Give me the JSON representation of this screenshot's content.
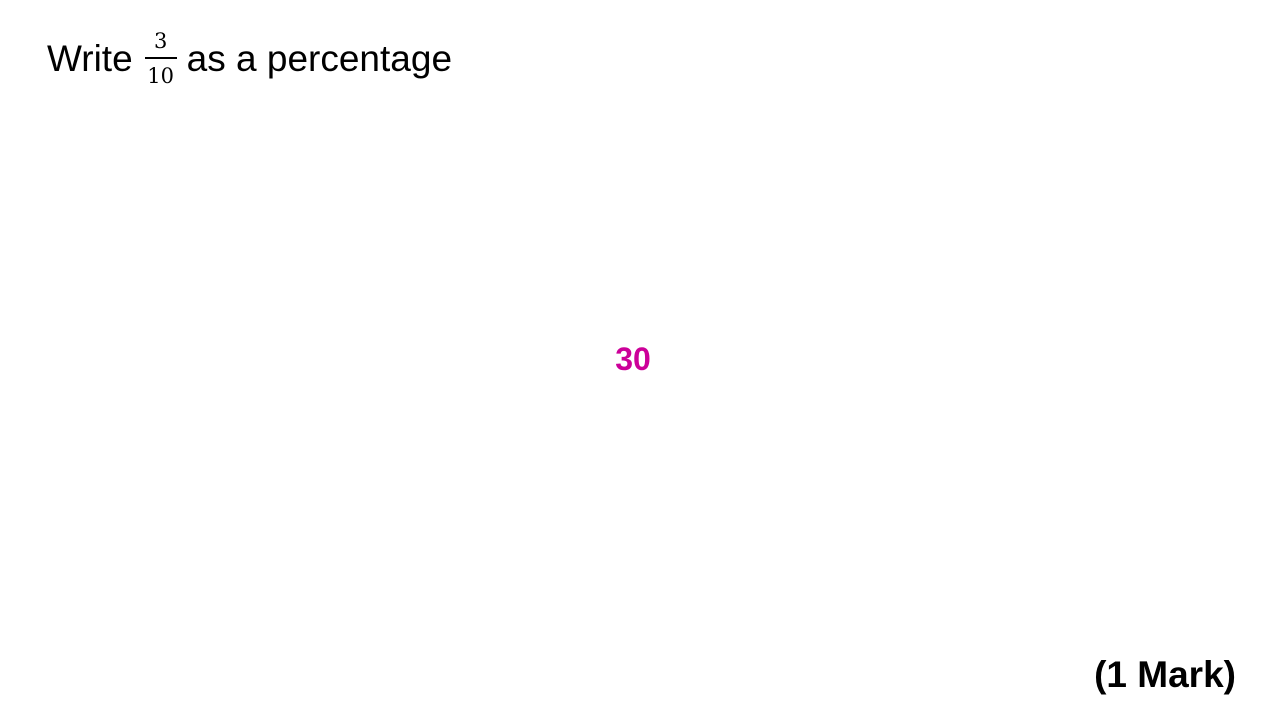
{
  "question": {
    "prefix": "Write",
    "fraction": {
      "numerator": "3",
      "denominator": "10"
    },
    "suffix": "as a percentage"
  },
  "answer": {
    "value": "30",
    "color": "#cc0099"
  },
  "marks": {
    "label": "(1 Mark)"
  }
}
